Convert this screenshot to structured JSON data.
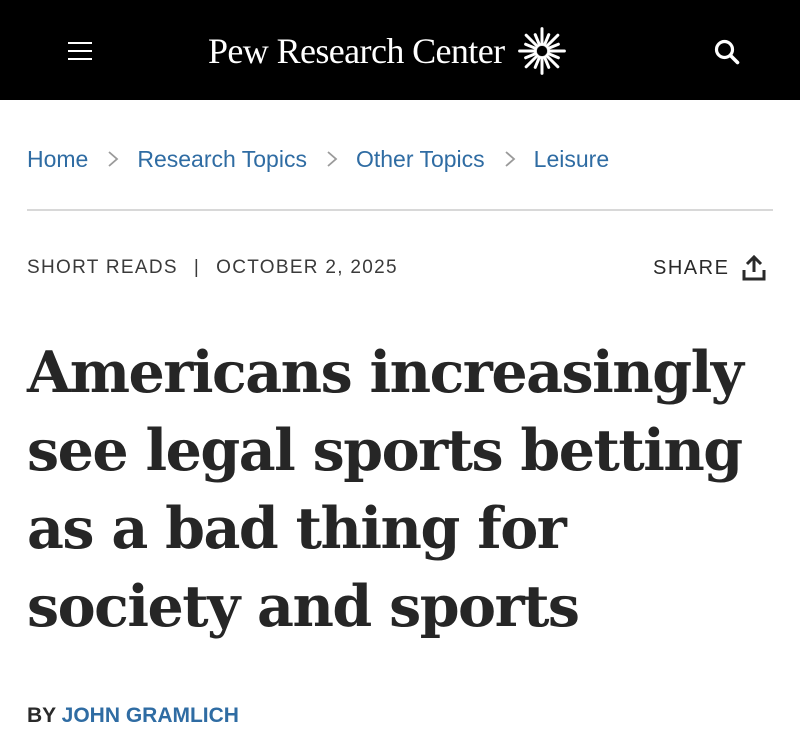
{
  "header": {
    "logo_text": "Pew Research Center",
    "menu_icon": "hamburger-menu-icon",
    "logo_icon": "sunburst-logo-icon",
    "search_icon": "search-icon",
    "background_color": "#000000"
  },
  "breadcrumb": {
    "items": [
      {
        "label": "Home"
      },
      {
        "label": "Research Topics"
      },
      {
        "label": "Other Topics"
      },
      {
        "label": "Leisure"
      }
    ],
    "separator_icon": "chevron-right-icon",
    "link_color": "#2f6ca3"
  },
  "meta": {
    "category": "SHORT READS",
    "separator": "|",
    "date": "OCTOBER 2, 2025"
  },
  "share": {
    "label": "SHARE",
    "icon": "share-upload-icon"
  },
  "article": {
    "headline_lines": [
      "Americans increasingly",
      "see legal sports betting",
      "as a bad thing for",
      "society and sports"
    ],
    "byline_prefix": "BY",
    "author": "JOHN GRAMLICH"
  }
}
